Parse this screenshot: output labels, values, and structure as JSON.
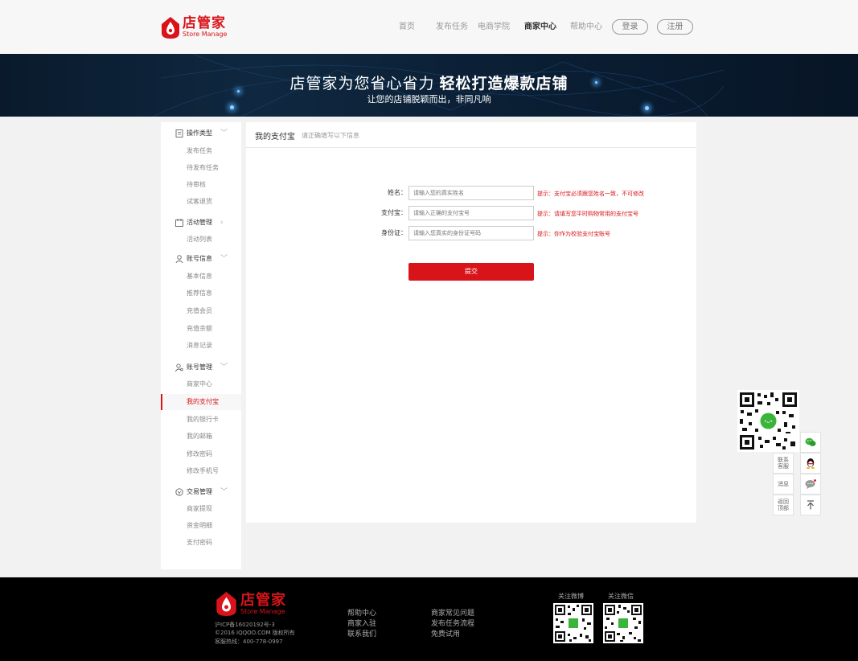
{
  "header": {
    "logo_cn": "店管家",
    "logo_en": "Store Manage",
    "nav": [
      "首页",
      "发布任务",
      "电商学院",
      "商家中心",
      "帮助中心"
    ],
    "active_nav": "商家中心",
    "login_label": "登录",
    "register_label": "注册"
  },
  "banner": {
    "title_normal": "店管家为您省心省力",
    "title_bold": "轻松打造爆款店铺",
    "subtitle": "让您的店铺脱颖而出，非同凡响"
  },
  "sidebar": {
    "groups": [
      {
        "label": "操作类型",
        "icon": "document-icon",
        "chevron": "﹀",
        "items": [
          "发布任务",
          "待发布任务",
          "待审核",
          "试客退货"
        ]
      },
      {
        "label": "活动管理",
        "icon": "calendar-icon",
        "chevron": "›",
        "items": [
          "活动列表"
        ]
      },
      {
        "label": "账号信息",
        "icon": "user-icon",
        "chevron": "﹀",
        "items": [
          "基本信息",
          "推荐信息",
          "充值会员",
          "充值余额",
          "消息记录"
        ]
      },
      {
        "label": "账号管理",
        "icon": "user-manage-icon",
        "chevron": "﹀",
        "items": [
          "商家中心",
          "我的支付宝",
          "我的银行卡",
          "我的邮箱",
          "修改密码",
          "修改手机号"
        ]
      },
      {
        "label": "交易管理",
        "icon": "trade-icon",
        "chevron": "﹀",
        "items": [
          "商家提现",
          "资金明细",
          "支付密码"
        ]
      }
    ],
    "active_item": "我的支付宝"
  },
  "panel": {
    "title": "我的支付宝",
    "subtitle": "请正确填写以下信息",
    "fields": [
      {
        "label": "姓名：",
        "placeholder": "请输入您的真实姓名",
        "hint": "提示：支付宝必须跟您姓名一致，不可修改"
      },
      {
        "label": "支付宝：",
        "placeholder": "请输入正确的支付宝号",
        "hint": "提示：请填写您平时购物常用的支付宝号"
      },
      {
        "label": "身份证：",
        "placeholder": "请输入您真实的身份证号码",
        "hint": "提示：你作为校验支付宝账号"
      }
    ],
    "submit_label": "提交"
  },
  "float_bar": {
    "contact_label": "联系\n客服",
    "message_label": "消息",
    "top_label": "返回\n顶部"
  },
  "footer": {
    "logo_cn": "店管家",
    "logo_en": "Store Manage",
    "icp": "沪ICP备16020192号-3",
    "copyright": "©2016 IQQOO.COM 版权所有",
    "hotline": "客服热线：400-778-0997",
    "links_col1": [
      "帮助中心",
      "商家入驻",
      "联系我们"
    ],
    "links_col2": [
      "商家常见问题",
      "发布任务流程",
      "免费试用"
    ],
    "qr_weibo_label": "关注微博",
    "qr_wechat_label": "关注微信"
  },
  "colors": {
    "brand_red": "#d8141a",
    "banner_dark": "#0b2036",
    "footer_bg": "#000000"
  }
}
